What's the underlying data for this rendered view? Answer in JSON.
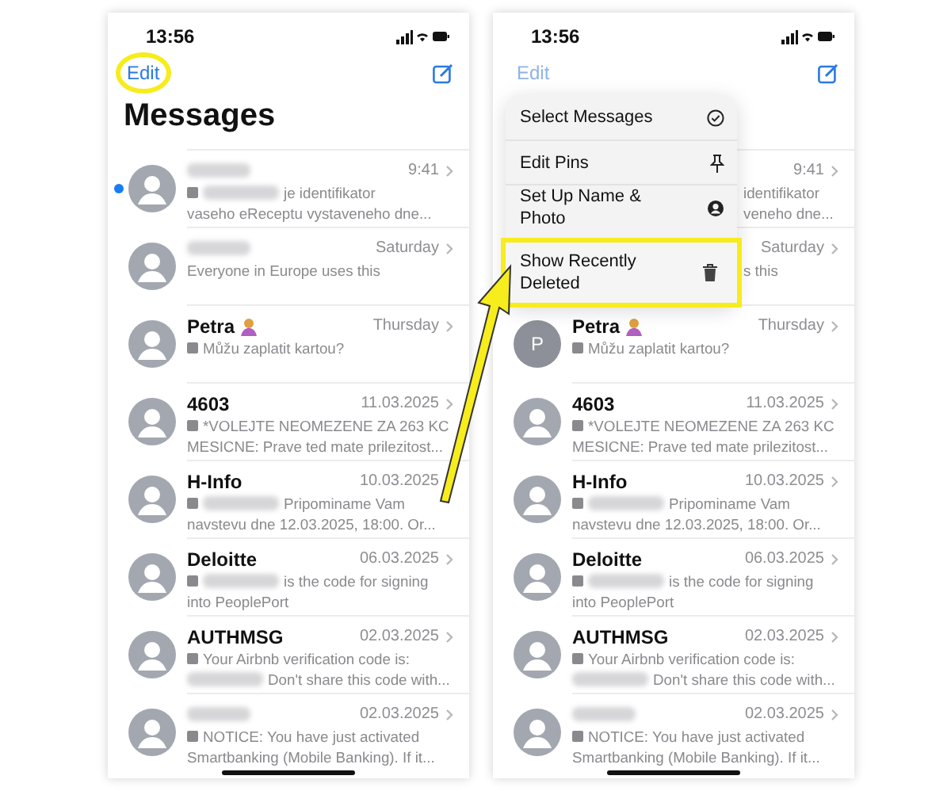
{
  "phones": [
    {
      "status_time": "13:56",
      "edit": {
        "label": "Edit",
        "highlighted": true,
        "dimmed": false
      },
      "title": "Messages",
      "rows": [
        {
          "kind": "full",
          "name_redacted": true,
          "time": "9:41",
          "unread": true,
          "sms_icon": true,
          "lines": [
            [
              {
                "kind": "redacted"
              },
              {
                "kind": "text",
                "text": "je identifikator"
              }
            ],
            [
              {
                "kind": "text",
                "text": "vaseho eReceptu vystaveneho dne..."
              }
            ]
          ]
        },
        {
          "kind": "full",
          "name_redacted": true,
          "time": "Saturday",
          "unread": false,
          "sms_icon": false,
          "lines": [
            [
              {
                "kind": "text",
                "text": "Everyone in Europe uses this"
              }
            ]
          ]
        },
        {
          "kind": "full",
          "name": "Petra",
          "emoji": true,
          "time": "Thursday",
          "unread": false,
          "sms_icon": true,
          "lines": [
            [
              {
                "kind": "text",
                "text": "Můžu zaplatit kartou?"
              }
            ]
          ]
        },
        {
          "kind": "full",
          "name": "4603",
          "time": "11.03.2025",
          "unread": false,
          "sms_icon": true,
          "lines": [
            [
              {
                "kind": "text",
                "text": "*VOLEJTE NEOMEZENE ZA 263 KC"
              }
            ],
            [
              {
                "kind": "text",
                "text": "MESICNE: Prave ted mate prilezitost..."
              }
            ]
          ]
        },
        {
          "kind": "full",
          "name": "H-Info",
          "time": "10.03.2025",
          "unread": false,
          "sms_icon": true,
          "lines": [
            [
              {
                "kind": "redacted"
              },
              {
                "kind": "text",
                "text": "Pripominame Vam"
              }
            ],
            [
              {
                "kind": "text",
                "text": "navstevu dne 12.03.2025, 18:00. Or..."
              }
            ]
          ]
        },
        {
          "kind": "full",
          "name": "Deloitte",
          "time": "06.03.2025",
          "unread": false,
          "sms_icon": true,
          "lines": [
            [
              {
                "kind": "redacted"
              },
              {
                "kind": "text",
                "text": "is the code for signing"
              }
            ],
            [
              {
                "kind": "text",
                "text": "into PeoplePort"
              }
            ]
          ]
        },
        {
          "kind": "full",
          "name": "AUTHMSG",
          "time": "02.03.2025",
          "unread": false,
          "sms_icon": true,
          "lines": [
            [
              {
                "kind": "text",
                "text": "Your Airbnb verification code is:"
              }
            ],
            [
              {
                "kind": "redacted"
              },
              {
                "kind": "text",
                "text": "Don't share this code with..."
              }
            ]
          ]
        },
        {
          "kind": "full",
          "name_redacted": true,
          "time": "02.03.2025",
          "unread": false,
          "sms_icon": true,
          "lines": [
            [
              {
                "kind": "text",
                "text": "NOTICE: You have just activated"
              }
            ],
            [
              {
                "kind": "text",
                "text": "Smartbanking (Mobile Banking). If it..."
              }
            ]
          ]
        }
      ]
    },
    {
      "status_time": "13:56",
      "edit": {
        "label": "Edit",
        "highlighted": false,
        "dimmed": true
      },
      "menu": {
        "items": [
          {
            "label": "Select Messages",
            "highlighted": false
          },
          {
            "label": "Edit Pins",
            "highlighted": false
          },
          {
            "label": "Set Up Name & Photo",
            "highlighted": false
          },
          {
            "label": "Show Recently Deleted",
            "highlighted": true
          }
        ]
      },
      "rows": [
        {
          "kind": "partial",
          "time": "9:41",
          "lines": [
            "identifikator",
            "veneho dne..."
          ]
        },
        {
          "kind": "partial",
          "time": "Saturday",
          "lines": [
            "s this"
          ]
        },
        {
          "kind": "full",
          "name": "Petra",
          "emoji": true,
          "time": "Thursday",
          "unread": false,
          "sms_icon": true,
          "letter": "P",
          "lines": [
            [
              {
                "kind": "text",
                "text": "Můžu zaplatit kartou?"
              }
            ]
          ]
        },
        {
          "kind": "full",
          "name": "4603",
          "time": "11.03.2025",
          "unread": false,
          "sms_icon": true,
          "lines": [
            [
              {
                "kind": "text",
                "text": "*VOLEJTE NEOMEZENE ZA 263 KC"
              }
            ],
            [
              {
                "kind": "text",
                "text": "MESICNE: Prave ted mate prilezitost..."
              }
            ]
          ]
        },
        {
          "kind": "full",
          "name": "H-Info",
          "time": "10.03.2025",
          "unread": false,
          "sms_icon": true,
          "lines": [
            [
              {
                "kind": "redacted"
              },
              {
                "kind": "text",
                "text": "Pripominame Vam"
              }
            ],
            [
              {
                "kind": "text",
                "text": "navstevu dne 12.03.2025, 18:00. Or..."
              }
            ]
          ]
        },
        {
          "kind": "full",
          "name": "Deloitte",
          "time": "06.03.2025",
          "unread": false,
          "sms_icon": true,
          "lines": [
            [
              {
                "kind": "redacted"
              },
              {
                "kind": "text",
                "text": "is the code for signing"
              }
            ],
            [
              {
                "kind": "text",
                "text": "into PeoplePort"
              }
            ]
          ]
        },
        {
          "kind": "full",
          "name": "AUTHMSG",
          "time": "02.03.2025",
          "unread": false,
          "sms_icon": true,
          "lines": [
            [
              {
                "kind": "text",
                "text": "Your Airbnb verification code is:"
              }
            ],
            [
              {
                "kind": "redacted"
              },
              {
                "kind": "text",
                "text": "Don't share this code with..."
              }
            ]
          ]
        },
        {
          "kind": "full",
          "name_redacted": true,
          "time": "02.03.2025",
          "unread": false,
          "sms_icon": true,
          "lines": [
            [
              {
                "kind": "text",
                "text": "NOTICE: You have just activated"
              }
            ],
            [
              {
                "kind": "text",
                "text": "Smartbanking (Mobile Banking). If it..."
              }
            ]
          ]
        }
      ]
    }
  ]
}
